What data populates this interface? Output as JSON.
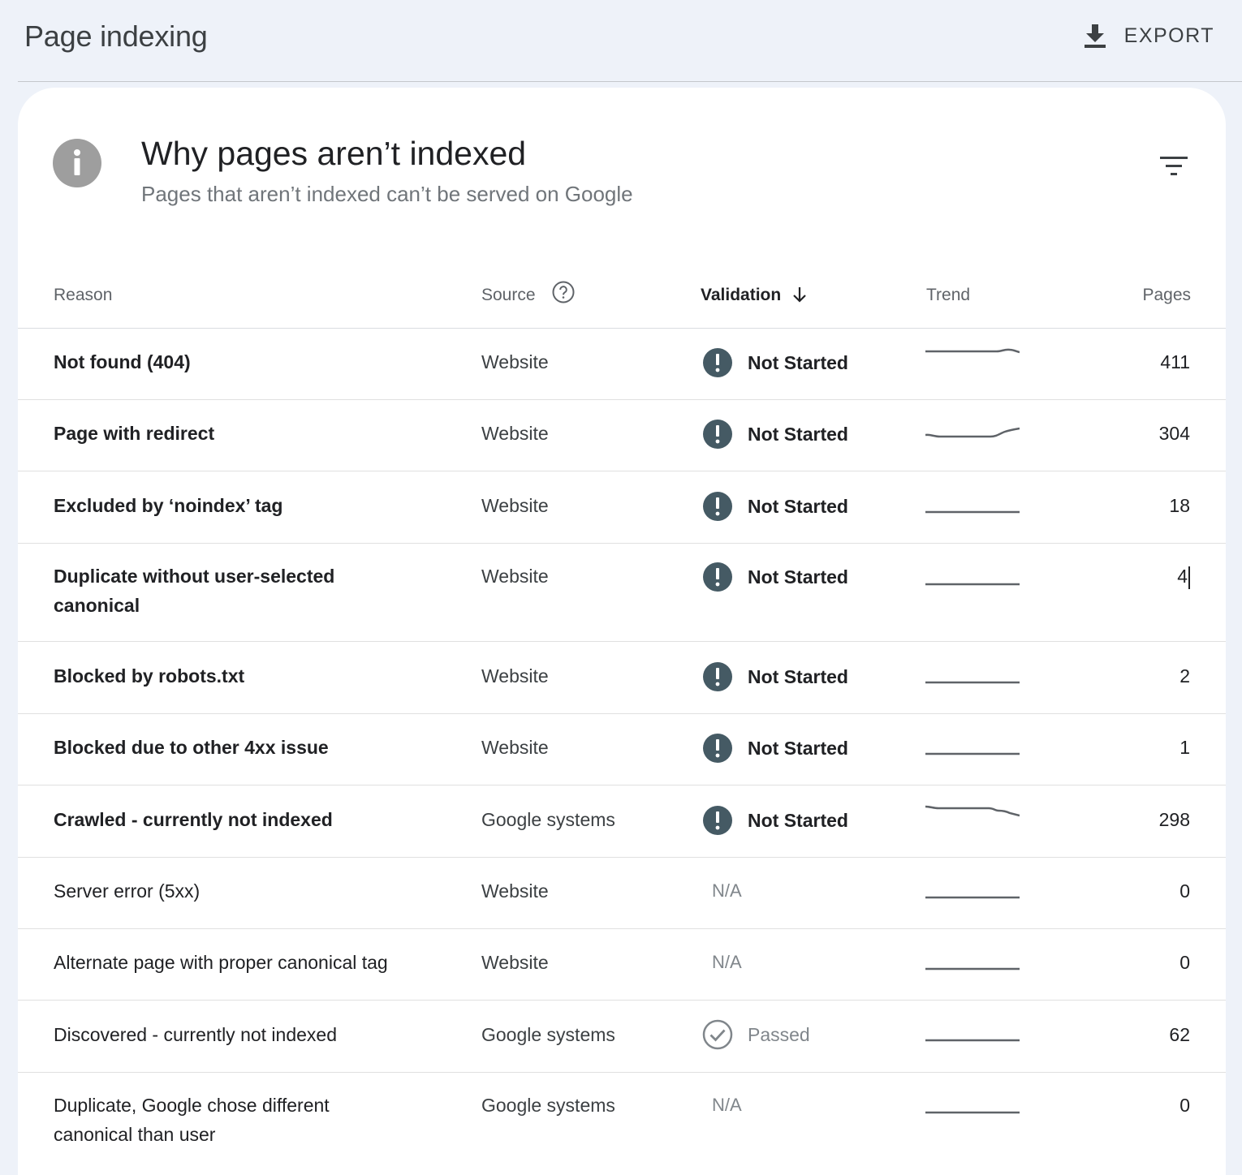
{
  "header": {
    "title": "Page indexing",
    "export_label": "EXPORT"
  },
  "card": {
    "title": "Why pages aren’t indexed",
    "subtitle": "Pages that aren’t indexed can’t be served on Google"
  },
  "table": {
    "columns": {
      "reason": "Reason",
      "source": "Source",
      "validation": "Validation",
      "trend": "Trend",
      "pages": "Pages"
    },
    "rows": [
      {
        "reason": "Not found (404)",
        "source": "Website",
        "validation": "Not Started",
        "pages": "411"
      },
      {
        "reason": "Page with redirect",
        "source": "Website",
        "validation": "Not Started",
        "pages": "304"
      },
      {
        "reason": "Excluded by ‘noindex’ tag",
        "source": "Website",
        "validation": "Not Started",
        "pages": "18"
      },
      {
        "reason": "Duplicate without user-selected canonical",
        "source": "Website",
        "validation": "Not Started",
        "pages": "4"
      },
      {
        "reason": "Blocked by robots.txt",
        "source": "Website",
        "validation": "Not Started",
        "pages": "2"
      },
      {
        "reason": "Blocked due to other 4xx issue",
        "source": "Website",
        "validation": "Not Started",
        "pages": "1"
      },
      {
        "reason": "Crawled - currently not indexed",
        "source": "Google systems",
        "validation": "Not Started",
        "pages": "298"
      },
      {
        "reason": "Server error (5xx)",
        "source": "Website",
        "validation": "N/A",
        "pages": "0"
      },
      {
        "reason": "Alternate page with proper canonical tag",
        "source": "Website",
        "validation": "N/A",
        "pages": "0"
      },
      {
        "reason": "Discovered - currently not indexed",
        "source": "Google systems",
        "validation": "Passed",
        "pages": "62"
      },
      {
        "reason": "Duplicate, Google chose different canonical than user",
        "source": "Google systems",
        "validation": "N/A",
        "pages": "0"
      }
    ]
  },
  "colors": {
    "status_icon": "#455a64",
    "trend_line": "#5f6368",
    "passed_icon": "#80868b"
  },
  "icons": {
    "export": "download-icon",
    "info": "info-icon",
    "filter": "filter-icon",
    "help": "help-circle-icon",
    "sort": "arrow-down-icon"
  }
}
